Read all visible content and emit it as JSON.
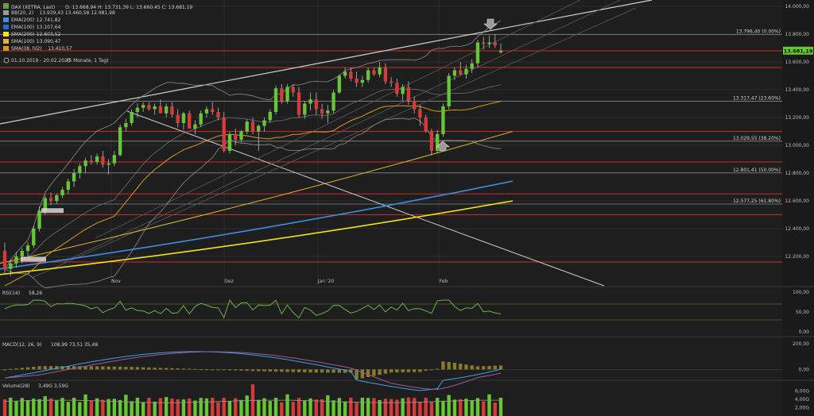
{
  "header": {
    "title": "DAX (XETRA, Last)",
    "ohlc": "O: 13.668,94  H: 13.731,39  L: 13.660,45  C: 13.681,19",
    "range": "01.10.2019 - 20.02.2020",
    "period": "(5 Monate, 1 Tag)"
  },
  "legend": [
    {
      "label": "BB(20, 2)",
      "value": "13.939,43  13.460,58  12.981,98",
      "color": "#9a9a9a"
    },
    {
      "label": "EMA(200)",
      "value": "12.741,82",
      "color": "#3d8fe0"
    },
    {
      "label": "EMA(100)",
      "value": "13.107,64",
      "color": "#2a6ad0"
    },
    {
      "label": "SMA(200)",
      "value": "12.603,52",
      "color": "#f2e41a"
    },
    {
      "label": "SMA(100)",
      "value": "13.090,47",
      "color": "#e0b43a"
    },
    {
      "label": "SMA(38, hl2)",
      "value": "13.410,57",
      "color": "#d39a28"
    }
  ],
  "colors": {
    "up": "#66c634",
    "down": "#d63a3a",
    "fib_line": "#c92a2a",
    "grid": "#2c2c2c"
  },
  "last_price": "13.681,19",
  "chart_data": [
    {
      "type": "candlestick",
      "x_labels": [
        "Nov",
        "Dez",
        "Jan '20",
        "Feb"
      ],
      "ylim": [
        12050,
        14050
      ],
      "y_ticks": [
        14000,
        13800,
        13600,
        13400,
        13200,
        13000,
        12800,
        12600,
        12400,
        12200
      ],
      "y_tick_labels": [
        "14.000,00",
        "13.800,00",
        "13.600,00",
        "13.400,00",
        "13.200,00",
        "13.000,00",
        "12.800,00",
        "12.600,00",
        "12.400,00",
        "12.200,00"
      ],
      "fib_levels": [
        {
          "value": 13796.4,
          "label": "13.796,40 (0.00%)"
        },
        {
          "value": 13317.47,
          "label": "13.317,47 (23.60%)"
        },
        {
          "value": 13029.55,
          "label": "13.029,55 (38.20%)"
        },
        {
          "value": 12801.41,
          "label": "12.801,41 (50.00%)"
        },
        {
          "value": 12577.25,
          "label": "12.577,25 (61.80%)"
        }
      ],
      "red_levels": [
        13680,
        13560,
        13100,
        12880,
        12650,
        12500,
        12160
      ],
      "candles": [
        [
          12240,
          12300,
          12080,
          12110
        ],
        [
          12110,
          12180,
          12060,
          12150
        ],
        [
          12150,
          12230,
          12120,
          12200
        ],
        [
          12200,
          12260,
          12150,
          12240
        ],
        [
          12240,
          12300,
          12200,
          12280
        ],
        [
          12280,
          12420,
          12260,
          12400
        ],
        [
          12400,
          12560,
          12380,
          12530
        ],
        [
          12530,
          12640,
          12500,
          12620
        ],
        [
          12620,
          12660,
          12570,
          12600
        ],
        [
          12600,
          12650,
          12580,
          12640
        ],
        [
          12640,
          12700,
          12620,
          12680
        ],
        [
          12680,
          12760,
          12650,
          12740
        ],
        [
          12740,
          12830,
          12700,
          12800
        ],
        [
          12800,
          12870,
          12760,
          12850
        ],
        [
          12850,
          12910,
          12800,
          12890
        ],
        [
          12890,
          12930,
          12860,
          12880
        ],
        [
          12880,
          12940,
          12860,
          12920
        ],
        [
          12920,
          12960,
          12840,
          12860
        ],
        [
          12860,
          12900,
          12790,
          12870
        ],
        [
          12870,
          12960,
          12850,
          12930
        ],
        [
          12930,
          13150,
          12920,
          13130
        ],
        [
          13130,
          13190,
          13100,
          13160
        ],
        [
          13160,
          13260,
          13140,
          13240
        ],
        [
          13240,
          13300,
          13200,
          13270
        ],
        [
          13270,
          13310,
          13240,
          13290
        ],
        [
          13290,
          13310,
          13250,
          13260
        ],
        [
          13260,
          13300,
          13220,
          13280
        ],
        [
          13280,
          13330,
          13240,
          13230
        ],
        [
          13230,
          13300,
          13200,
          13280
        ],
        [
          13280,
          13310,
          13200,
          13220
        ],
        [
          13220,
          13260,
          13130,
          13160
        ],
        [
          13160,
          13240,
          13110,
          13230
        ],
        [
          13230,
          13250,
          13120,
          13120
        ],
        [
          13120,
          13180,
          13080,
          13150
        ],
        [
          13150,
          13250,
          13130,
          13230
        ],
        [
          13230,
          13280,
          13200,
          13260
        ],
        [
          13260,
          13310,
          13220,
          13240
        ],
        [
          13240,
          13270,
          13180,
          13200
        ],
        [
          13200,
          13240,
          12950,
          12960
        ],
        [
          12960,
          13100,
          12940,
          13080
        ],
        [
          13080,
          13120,
          13000,
          13040
        ],
        [
          13040,
          13110,
          13020,
          13100
        ],
        [
          13100,
          13190,
          13080,
          13170
        ],
        [
          13170,
          13200,
          13080,
          13100
        ],
        [
          13100,
          13150,
          12960,
          13140
        ],
        [
          13140,
          13200,
          13100,
          13180
        ],
        [
          13180,
          13260,
          13160,
          13240
        ],
        [
          13240,
          13430,
          13220,
          13410
        ],
        [
          13410,
          13440,
          13300,
          13320
        ],
        [
          13320,
          13440,
          13300,
          13420
        ],
        [
          13420,
          13440,
          13350,
          13380
        ],
        [
          13380,
          13420,
          13200,
          13220
        ],
        [
          13220,
          13320,
          13190,
          13300
        ],
        [
          13300,
          13380,
          13250,
          13330
        ],
        [
          13330,
          13380,
          13220,
          13260
        ],
        [
          13260,
          13300,
          13190,
          13230
        ],
        [
          13230,
          13290,
          13160,
          13250
        ],
        [
          13250,
          13400,
          13230,
          13380
        ],
        [
          13380,
          13510,
          13370,
          13500
        ],
        [
          13500,
          13560,
          13480,
          13530
        ],
        [
          13530,
          13560,
          13460,
          13480
        ],
        [
          13480,
          13530,
          13420,
          13450
        ],
        [
          13450,
          13500,
          13420,
          13470
        ],
        [
          13470,
          13560,
          13450,
          13540
        ],
        [
          13540,
          13560,
          13500,
          13510
        ],
        [
          13510,
          13600,
          13490,
          13560
        ],
        [
          13560,
          13590,
          13440,
          13460
        ],
        [
          13460,
          13490,
          13420,
          13450
        ],
        [
          13450,
          13480,
          13350,
          13370
        ],
        [
          13370,
          13440,
          13320,
          13420
        ],
        [
          13420,
          13460,
          13290,
          13320
        ],
        [
          13320,
          13350,
          13230,
          13260
        ],
        [
          13260,
          13290,
          13140,
          13200
        ],
        [
          13200,
          13220,
          13090,
          13100
        ],
        [
          13100,
          13120,
          12930,
          12960
        ],
        [
          12960,
          13110,
          12940,
          13080
        ],
        [
          13080,
          13300,
          13060,
          13280
        ],
        [
          13280,
          13520,
          13260,
          13500
        ],
        [
          13500,
          13560,
          13470,
          13540
        ],
        [
          13540,
          13600,
          13500,
          13510
        ],
        [
          13510,
          13580,
          13480,
          13550
        ],
        [
          13550,
          13620,
          13520,
          13590
        ],
        [
          13590,
          13760,
          13560,
          13740
        ],
        [
          13740,
          13780,
          13690,
          13730
        ],
        [
          13730,
          13790,
          13700,
          13740
        ],
        [
          13740,
          13800,
          13700,
          13720
        ],
        [
          13668.94,
          13731.39,
          13660.45,
          13681.19
        ]
      ]
    },
    {
      "type": "line",
      "title": "RSI(14)",
      "value": "58,26",
      "y_ticks": [
        "100,00",
        "50,00",
        "0,00"
      ],
      "ylim": [
        0,
        100
      ]
    },
    {
      "type": "line",
      "title": "MACD(12, 26, 9)",
      "value": "108,99  73,51  35,48",
      "y_ticks": [
        "200,00",
        "0,00"
      ],
      "ylim": [
        -60,
        220
      ]
    },
    {
      "type": "bar",
      "title": "Volume(28)",
      "value": "3,49G  3,59G",
      "y_ticks": [
        "6,00G",
        "4,00G",
        "2,00G"
      ],
      "ylim": [
        0,
        8
      ]
    }
  ]
}
